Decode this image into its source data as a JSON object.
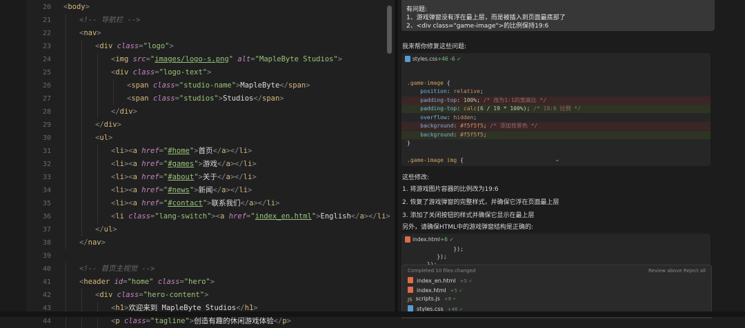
{
  "editor": {
    "lines": [
      {
        "n": "20",
        "tokens": [
          [
            "p",
            "<"
          ],
          [
            "t",
            "body"
          ],
          [
            "p",
            ">"
          ]
        ]
      },
      {
        "n": "21",
        "tokens": [
          [
            "c",
            "<!-- 导航栏 -->"
          ]
        ]
      },
      {
        "n": "22",
        "tokens": [
          [
            "p",
            "<"
          ],
          [
            "t",
            "nav"
          ],
          [
            "p",
            ">"
          ]
        ]
      },
      {
        "n": "23",
        "tokens": [
          [
            "p",
            "<"
          ],
          [
            "t",
            "div "
          ],
          [
            "a",
            "class"
          ],
          [
            "p",
            "="
          ],
          [
            "s",
            "\"logo\""
          ],
          [
            "p",
            ">"
          ]
        ]
      },
      {
        "n": "24",
        "tokens": [
          [
            "p",
            "<"
          ],
          [
            "t",
            "img "
          ],
          [
            "a",
            "src"
          ],
          [
            "p",
            "="
          ],
          [
            "s",
            "\""
          ],
          [
            "u",
            "images/logo-s.png"
          ],
          [
            "s",
            "\" "
          ],
          [
            "a",
            "alt"
          ],
          [
            "p",
            "="
          ],
          [
            "s",
            "\"MapleByte Studios\""
          ],
          [
            "p",
            ">"
          ]
        ]
      },
      {
        "n": "25",
        "tokens": [
          [
            "p",
            "<"
          ],
          [
            "t",
            "div "
          ],
          [
            "a",
            "class"
          ],
          [
            "p",
            "="
          ],
          [
            "s",
            "\"logo-text\""
          ],
          [
            "p",
            ">"
          ]
        ]
      },
      {
        "n": "26",
        "tokens": [
          [
            "p",
            "<"
          ],
          [
            "t",
            "span "
          ],
          [
            "a",
            "class"
          ],
          [
            "p",
            "="
          ],
          [
            "s",
            "\"studio-name\""
          ],
          [
            "p",
            ">"
          ],
          [
            "w",
            "MapleByte"
          ],
          [
            "p",
            "</"
          ],
          [
            "t",
            "span"
          ],
          [
            "p",
            ">"
          ]
        ]
      },
      {
        "n": "27",
        "tokens": [
          [
            "p",
            "<"
          ],
          [
            "t",
            "span "
          ],
          [
            "a",
            "class"
          ],
          [
            "p",
            "="
          ],
          [
            "s",
            "\"studios\""
          ],
          [
            "p",
            ">"
          ],
          [
            "w",
            "Studios"
          ],
          [
            "p",
            "</"
          ],
          [
            "t",
            "span"
          ],
          [
            "p",
            ">"
          ]
        ]
      },
      {
        "n": "28",
        "tokens": [
          [
            "p",
            "</"
          ],
          [
            "t",
            "div"
          ],
          [
            "p",
            ">"
          ]
        ]
      },
      {
        "n": "29",
        "tokens": [
          [
            "p",
            "</"
          ],
          [
            "t",
            "div"
          ],
          [
            "p",
            ">"
          ]
        ]
      },
      {
        "n": "30",
        "tokens": [
          [
            "p",
            "<"
          ],
          [
            "t",
            "ul"
          ],
          [
            "p",
            ">"
          ]
        ]
      },
      {
        "n": "31",
        "tokens": [
          [
            "p",
            "<"
          ],
          [
            "t",
            "li"
          ],
          [
            "p",
            "><"
          ],
          [
            "t",
            "a "
          ],
          [
            "a",
            "href"
          ],
          [
            "p",
            "="
          ],
          [
            "s",
            "\""
          ],
          [
            "u",
            "#home"
          ],
          [
            "s",
            "\""
          ],
          [
            "p",
            ">"
          ],
          [
            "w",
            "首页"
          ],
          [
            "p",
            "</"
          ],
          [
            "t",
            "a"
          ],
          [
            "p",
            "></"
          ],
          [
            "t",
            "li"
          ],
          [
            "p",
            ">"
          ]
        ]
      },
      {
        "n": "32",
        "tokens": [
          [
            "p",
            "<"
          ],
          [
            "t",
            "li"
          ],
          [
            "p",
            "><"
          ],
          [
            "t",
            "a "
          ],
          [
            "a",
            "href"
          ],
          [
            "p",
            "="
          ],
          [
            "s",
            "\""
          ],
          [
            "u",
            "#games"
          ],
          [
            "s",
            "\""
          ],
          [
            "p",
            ">"
          ],
          [
            "w",
            "游戏"
          ],
          [
            "p",
            "</"
          ],
          [
            "t",
            "a"
          ],
          [
            "p",
            "></"
          ],
          [
            "t",
            "li"
          ],
          [
            "p",
            ">"
          ]
        ]
      },
      {
        "n": "33",
        "tokens": [
          [
            "p",
            "<"
          ],
          [
            "t",
            "li"
          ],
          [
            "p",
            "><"
          ],
          [
            "t",
            "a "
          ],
          [
            "a",
            "href"
          ],
          [
            "p",
            "="
          ],
          [
            "s",
            "\""
          ],
          [
            "u",
            "#about"
          ],
          [
            "s",
            "\""
          ],
          [
            "p",
            ">"
          ],
          [
            "w",
            "关于"
          ],
          [
            "p",
            "</"
          ],
          [
            "t",
            "a"
          ],
          [
            "p",
            "></"
          ],
          [
            "t",
            "li"
          ],
          [
            "p",
            ">"
          ]
        ]
      },
      {
        "n": "34",
        "tokens": [
          [
            "p",
            "<"
          ],
          [
            "t",
            "li"
          ],
          [
            "p",
            "><"
          ],
          [
            "t",
            "a "
          ],
          [
            "a",
            "href"
          ],
          [
            "p",
            "="
          ],
          [
            "s",
            "\""
          ],
          [
            "u",
            "#news"
          ],
          [
            "s",
            "\""
          ],
          [
            "p",
            ">"
          ],
          [
            "w",
            "新闻"
          ],
          [
            "p",
            "</"
          ],
          [
            "t",
            "a"
          ],
          [
            "p",
            "></"
          ],
          [
            "t",
            "li"
          ],
          [
            "p",
            ">"
          ]
        ]
      },
      {
        "n": "35",
        "tokens": [
          [
            "p",
            "<"
          ],
          [
            "t",
            "li"
          ],
          [
            "p",
            "><"
          ],
          [
            "t",
            "a "
          ],
          [
            "a",
            "href"
          ],
          [
            "p",
            "="
          ],
          [
            "s",
            "\""
          ],
          [
            "u",
            "#contact"
          ],
          [
            "s",
            "\""
          ],
          [
            "p",
            ">"
          ],
          [
            "w",
            "联系我们"
          ],
          [
            "p",
            "</"
          ],
          [
            "t",
            "a"
          ],
          [
            "p",
            "></"
          ],
          [
            "t",
            "li"
          ],
          [
            "p",
            ">"
          ]
        ]
      },
      {
        "n": "36",
        "tokens": [
          [
            "p",
            "<"
          ],
          [
            "t",
            "li "
          ],
          [
            "a",
            "class"
          ],
          [
            "p",
            "="
          ],
          [
            "s",
            "\"lang-switch\""
          ],
          [
            "p",
            "><"
          ],
          [
            "t",
            "a "
          ],
          [
            "a",
            "href"
          ],
          [
            "p",
            "="
          ],
          [
            "s",
            "\""
          ],
          [
            "u",
            "index_en.html"
          ],
          [
            "s",
            "\""
          ],
          [
            "p",
            ">"
          ],
          [
            "w",
            "English"
          ],
          [
            "p",
            "</"
          ],
          [
            "t",
            "a"
          ],
          [
            "p",
            "></"
          ],
          [
            "t",
            "li"
          ],
          [
            "p",
            ">"
          ]
        ]
      },
      {
        "n": "37",
        "tokens": [
          [
            "p",
            "</"
          ],
          [
            "t",
            "ul"
          ],
          [
            "p",
            ">"
          ]
        ]
      },
      {
        "n": "38",
        "tokens": [
          [
            "p",
            "</"
          ],
          [
            "t",
            "nav"
          ],
          [
            "p",
            ">"
          ]
        ]
      },
      {
        "n": "39",
        "tokens": []
      },
      {
        "n": "40",
        "tokens": [
          [
            "c",
            "<!-- 首页主视觉 -->"
          ]
        ]
      },
      {
        "n": "41",
        "tokens": [
          [
            "p",
            "<"
          ],
          [
            "t",
            "header "
          ],
          [
            "a",
            "id"
          ],
          [
            "p",
            "="
          ],
          [
            "s",
            "\"home\" "
          ],
          [
            "a",
            "class"
          ],
          [
            "p",
            "="
          ],
          [
            "s",
            "\"hero\""
          ],
          [
            "p",
            ">"
          ]
        ]
      },
      {
        "n": "42",
        "tokens": [
          [
            "p",
            "<"
          ],
          [
            "t",
            "div "
          ],
          [
            "a",
            "class"
          ],
          [
            "p",
            "="
          ],
          [
            "s",
            "\"hero-content\""
          ],
          [
            "p",
            ">"
          ]
        ]
      },
      {
        "n": "43",
        "tokens": [
          [
            "p",
            "<"
          ],
          [
            "t",
            "h1"
          ],
          [
            "p",
            ">"
          ],
          [
            "w",
            "欢迎来到 MapleByte Studios"
          ],
          [
            "p",
            "</"
          ],
          [
            "t",
            "h1"
          ],
          [
            "p",
            ">"
          ]
        ]
      },
      {
        "n": "44",
        "tokens": [
          [
            "p",
            "<"
          ],
          [
            "t",
            "p "
          ],
          [
            "a",
            "class"
          ],
          [
            "p",
            "="
          ],
          [
            "s",
            "\"tagline\""
          ],
          [
            "p",
            ">"
          ],
          [
            "w",
            "创造有趣的休闲游戏体验"
          ],
          [
            "p",
            "</"
          ],
          [
            "t",
            "p"
          ],
          [
            "p",
            ">"
          ]
        ]
      }
    ]
  },
  "chat": {
    "issue_title": "有问题:",
    "issue_1": "1、游戏弹窗没有浮在最上层，而是被插入到页面最底部了",
    "issue_2": "2、<div class=\"game-image\">的比例保持19:6",
    "intro": "我来帮你修复这些问题:",
    "diff1": {
      "file": "styles.css",
      "stat": "+46 -6 ✓",
      "lines": [
        {
          "kind": "ctx",
          "tokens": []
        },
        {
          "kind": "ctx",
          "tokens": [
            [
              "cs",
              ".game-image"
            ],
            [
              "cw",
              " {"
            ]
          ]
        },
        {
          "kind": "ctx",
          "tokens": [
            [
              "cw",
              "    "
            ],
            [
              "cp",
              "position"
            ],
            [
              "cw",
              ": "
            ],
            [
              "cv",
              "relative"
            ],
            [
              "cw",
              ";"
            ]
          ]
        },
        {
          "kind": "del",
          "tokens": [
            [
              "cw",
              "    "
            ],
            [
              "cp",
              "padding-top"
            ],
            [
              "cw",
              ": "
            ],
            [
              "cn",
              "100%"
            ],
            [
              "cw",
              "; "
            ],
            [
              "cc",
              "/* 改为1:1的宽高比 */"
            ]
          ]
        },
        {
          "kind": "add",
          "tokens": [
            [
              "cw",
              "    "
            ],
            [
              "cp",
              "padding-top"
            ],
            [
              "cw",
              ": "
            ],
            [
              "cv",
              "calc"
            ],
            [
              "cw",
              "("
            ],
            [
              "cn",
              "6"
            ],
            [
              "cw",
              " / "
            ],
            [
              "cn",
              "19"
            ],
            [
              "cw",
              " * "
            ],
            [
              "cn",
              "100%"
            ],
            [
              "cw",
              "); "
            ],
            [
              "cc",
              "/* 19:6 比例 */"
            ]
          ]
        },
        {
          "kind": "ctx",
          "tokens": [
            [
              "cw",
              "    "
            ],
            [
              "cp",
              "overflow"
            ],
            [
              "cw",
              ": "
            ],
            [
              "cv",
              "hidden"
            ],
            [
              "cw",
              ";"
            ]
          ]
        },
        {
          "kind": "del",
          "tokens": [
            [
              "cw",
              "    "
            ],
            [
              "cp",
              "background"
            ],
            [
              "cw",
              ": "
            ],
            [
              "cv",
              "#f5f5f5"
            ],
            [
              "cw",
              "; "
            ],
            [
              "cc",
              "/* 添加背景色 */"
            ]
          ]
        },
        {
          "kind": "add",
          "tokens": [
            [
              "cw",
              "    "
            ],
            [
              "cp",
              "background"
            ],
            [
              "cw",
              ": "
            ],
            [
              "cv",
              "#f5f5f5"
            ],
            [
              "cw",
              ";"
            ]
          ]
        },
        {
          "kind": "ctx",
          "tokens": [
            [
              "cw",
              "}"
            ]
          ]
        },
        {
          "kind": "ctx",
          "tokens": []
        },
        {
          "kind": "ctx",
          "tokens": [
            [
              "cs",
              ".game-image img"
            ],
            [
              "cw",
              " {"
            ]
          ]
        }
      ],
      "expand": "⌄"
    },
    "summary_title": "这些修改:",
    "changes": [
      "1. 将游戏图片容器的比例改为19:6",
      "2. 恢复了游戏弹窗的完整样式，并确保它浮在页面最上层",
      "3. 添加了关闭按钮的样式并确保它显示在最上层"
    ],
    "html_note": "另外，请确保HTML中的游戏弹窗结构是正确的:",
    "diff2": {
      "file": "index.html",
      "stat": "+6 ✓",
      "lines": [
        "              });",
        "         });",
        "      });"
      ]
    },
    "panel": {
      "header": "Completed 10 files changed",
      "actions": "Review above   Reject all",
      "files": [
        {
          "icon": "html",
          "name": "index_en.html",
          "status": "+5 ✓"
        },
        {
          "icon": "html",
          "name": "index.html",
          "status": "+5 ✓"
        },
        {
          "icon": "js",
          "name": "scripts.js",
          "status": "+8 •"
        },
        {
          "icon": "css",
          "name": "styles.css",
          "status": "+46 ✓"
        }
      ]
    }
  },
  "colors": {
    "editor_bg": "#202020",
    "chat_bg": "#1c1c1c",
    "tag": "#d7ba7d",
    "attribute": "#c586c0",
    "string": "#98c379",
    "added_bg": "#2e3324",
    "removed_bg": "#3a2626"
  }
}
